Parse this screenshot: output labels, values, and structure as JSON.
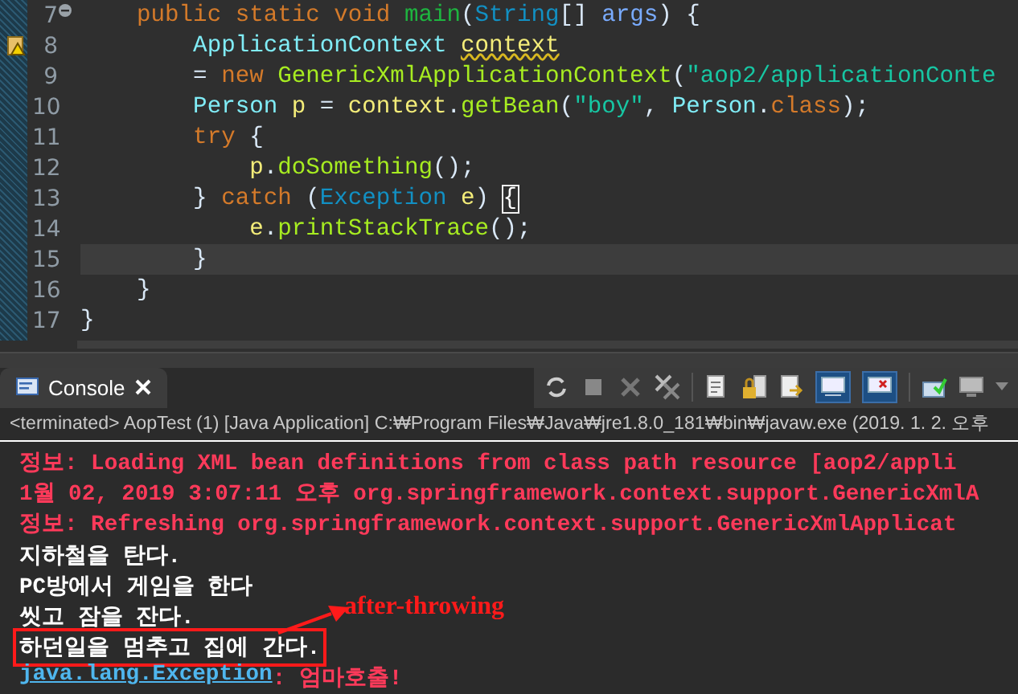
{
  "editor": {
    "lines": [
      {
        "number": "7",
        "fold_toggle": true,
        "warning": false,
        "current": false,
        "tokens": [
          {
            "text": "    public static void ",
            "kind": "keyword"
          },
          {
            "text": "main",
            "kind": "method-decl"
          },
          {
            "text": "(",
            "kind": "plain"
          },
          {
            "text": "String",
            "kind": "type"
          },
          {
            "text": "[] ",
            "kind": "plain"
          },
          {
            "text": "args",
            "kind": "param"
          },
          {
            "text": ") {",
            "kind": "plain"
          }
        ]
      },
      {
        "number": "8",
        "fold_toggle": false,
        "warning": true,
        "current": false,
        "tokens": [
          {
            "text": "        ApplicationContext ",
            "kind": "class"
          },
          {
            "text": "context",
            "kind": "warning-var"
          }
        ]
      },
      {
        "number": "9",
        "fold_toggle": false,
        "warning": false,
        "current": false,
        "tokens": [
          {
            "text": "        = ",
            "kind": "plain"
          },
          {
            "text": "new ",
            "kind": "keyword"
          },
          {
            "text": "GenericXmlApplicationContext",
            "kind": "method"
          },
          {
            "text": "(",
            "kind": "plain"
          },
          {
            "text": "\"aop2/applicationConte",
            "kind": "string"
          }
        ]
      },
      {
        "number": "10",
        "fold_toggle": false,
        "warning": false,
        "current": false,
        "tokens": [
          {
            "text": "        Person ",
            "kind": "class"
          },
          {
            "text": "p",
            "kind": "local"
          },
          {
            "text": " = ",
            "kind": "plain"
          },
          {
            "text": "context",
            "kind": "local"
          },
          {
            "text": ".",
            "kind": "plain"
          },
          {
            "text": "getBean",
            "kind": "method"
          },
          {
            "text": "(",
            "kind": "plain"
          },
          {
            "text": "\"boy\"",
            "kind": "string"
          },
          {
            "text": ", ",
            "kind": "plain"
          },
          {
            "text": "Person",
            "kind": "class"
          },
          {
            "text": ".",
            "kind": "plain"
          },
          {
            "text": "class",
            "kind": "keyword"
          },
          {
            "text": ");",
            "kind": "plain"
          }
        ]
      },
      {
        "number": "11",
        "fold_toggle": false,
        "warning": false,
        "current": false,
        "tokens": [
          {
            "text": "        try",
            "kind": "keyword"
          },
          {
            "text": " {",
            "kind": "plain"
          }
        ]
      },
      {
        "number": "12",
        "fold_toggle": false,
        "warning": false,
        "current": false,
        "tokens": [
          {
            "text": "            p",
            "kind": "local"
          },
          {
            "text": ".",
            "kind": "plain"
          },
          {
            "text": "doSomething",
            "kind": "method"
          },
          {
            "text": "();",
            "kind": "plain"
          }
        ]
      },
      {
        "number": "13",
        "fold_toggle": false,
        "warning": false,
        "current": false,
        "tokens": [
          {
            "text": "        } ",
            "kind": "plain"
          },
          {
            "text": "catch",
            "kind": "keyword"
          },
          {
            "text": " (",
            "kind": "plain"
          },
          {
            "text": "Exception ",
            "kind": "type"
          },
          {
            "text": "e",
            "kind": "local"
          },
          {
            "text": ") ",
            "kind": "plain"
          },
          {
            "text": "{",
            "kind": "matched-bracket"
          }
        ]
      },
      {
        "number": "14",
        "fold_toggle": false,
        "warning": false,
        "current": false,
        "tokens": [
          {
            "text": "            e",
            "kind": "local"
          },
          {
            "text": ".",
            "kind": "plain"
          },
          {
            "text": "printStackTrace",
            "kind": "method"
          },
          {
            "text": "();",
            "kind": "plain"
          }
        ]
      },
      {
        "number": "15",
        "fold_toggle": false,
        "warning": false,
        "current": true,
        "tokens": [
          {
            "text": "        }",
            "kind": "plain"
          }
        ]
      },
      {
        "number": "16",
        "fold_toggle": false,
        "warning": false,
        "current": false,
        "tokens": [
          {
            "text": "    }",
            "kind": "plain"
          }
        ]
      },
      {
        "number": "17",
        "fold_toggle": false,
        "warning": false,
        "current": false,
        "tokens": [
          {
            "text": "}",
            "kind": "plain"
          }
        ]
      }
    ]
  },
  "console": {
    "tab": {
      "label": "Console",
      "selected": true
    },
    "status": "<terminated> AopTest (1) [Java Application] C:₩Program Files₩Java₩jre1.8.0_181₩bin₩javaw.exe (2019. 1. 2. 오후",
    "lines": [
      {
        "boxed": false,
        "segments": [
          {
            "text": "정보: Loading XML bean definitions from class path resource [aop2/appli",
            "kind": "error"
          }
        ]
      },
      {
        "boxed": false,
        "segments": [
          {
            "text": "1월 02, 2019 3:07:11 오후 org.springframework.context.support.GenericXmlA",
            "kind": "error"
          }
        ]
      },
      {
        "boxed": false,
        "segments": [
          {
            "text": "정보: Refreshing org.springframework.context.support.GenericXmlApplicat",
            "kind": "error"
          }
        ]
      },
      {
        "boxed": false,
        "segments": [
          {
            "text": "지하철을 탄다.",
            "kind": "out"
          }
        ]
      },
      {
        "boxed": false,
        "segments": [
          {
            "text": "PC방에서 게임을 한다",
            "kind": "out"
          }
        ]
      },
      {
        "boxed": false,
        "segments": [
          {
            "text": "씻고 잠을 잔다.",
            "kind": "out"
          }
        ]
      },
      {
        "boxed": true,
        "segments": [
          {
            "text": "하던일을 멈추고 집에 간다.",
            "kind": "out"
          }
        ]
      },
      {
        "boxed": false,
        "segments": [
          {
            "text": "java.lang.Exception",
            "kind": "link"
          },
          {
            "text": ": 엄마호출!",
            "kind": "error"
          }
        ]
      }
    ]
  },
  "annotation": {
    "label": "after-throwing"
  }
}
